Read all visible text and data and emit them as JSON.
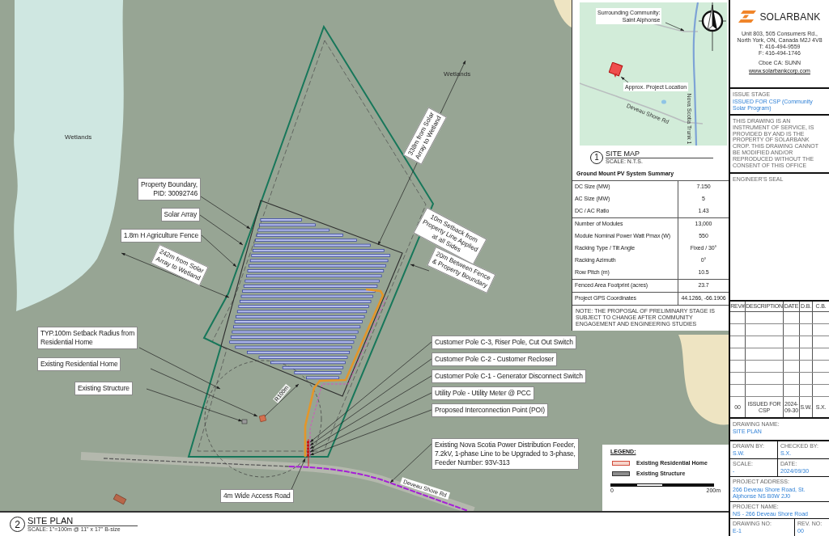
{
  "site_plan": {
    "area_labels": [
      "Wetlands",
      "Wetlands"
    ],
    "dimension_labels": [
      {
        "lines": [
          "338m from Solar",
          "Array to Wetland"
        ]
      },
      {
        "lines": [
          "242m from Solar",
          "Array to Wetland"
        ]
      },
      {
        "lines": [
          "10m Setback from",
          "Property Line Applied",
          "at all Sides"
        ]
      },
      {
        "lines": [
          "20m Between Fence",
          "& Property Boundary"
        ]
      },
      {
        "lines": [
          "R100m"
        ]
      }
    ],
    "callouts": [
      {
        "lines": [
          "Property Boundary,",
          "PID: 30092746"
        ]
      },
      {
        "lines": [
          "Solar Array"
        ]
      },
      {
        "lines": [
          "1.8m H Agriculture Fence"
        ]
      },
      {
        "lines": [
          "TYP.100m Setback Radius from",
          "Residential Home"
        ]
      },
      {
        "lines": [
          "Existing Residential Home"
        ]
      },
      {
        "lines": [
          "Existing Structure"
        ]
      },
      {
        "lines": [
          "Customer Pole C-3, Riser Pole, Cut Out Switch"
        ]
      },
      {
        "lines": [
          "Customer Pole C-2 - Customer Recloser"
        ]
      },
      {
        "lines": [
          "Customer Pole C-1 - Generator Disconnect Switch"
        ]
      },
      {
        "lines": [
          "Utility Pole - Utility Meter @ PCC"
        ]
      },
      {
        "lines": [
          "Proposed Interconnection Point (POI)"
        ]
      },
      {
        "lines": [
          "Existing Nova Scotia Power Distribution Feeder,",
          "7.2kV, 1-phase Line to be Upgraded to 3-phase,",
          "Feeder Number: 93V-313"
        ]
      },
      {
        "lines": [
          "4m Wide Access Road"
        ]
      }
    ],
    "road_label": "Deveau Shore Rd",
    "legend": {
      "title": "LEGEND:",
      "items": [
        {
          "label": "Existing Residential Home",
          "color": "#f6d5cb"
        },
        {
          "label": "Existing Structure",
          "color": "#8e8e8e"
        }
      ],
      "scale_start": "0",
      "scale_end": "200m"
    },
    "title": {
      "number": "2",
      "name": "SITE PLAN",
      "scale": "SCALE: 1\"=100m @ 11\" x 17\" B-size"
    }
  },
  "site_map": {
    "labels": [
      {
        "lines": [
          "Surrounding Community:",
          "Saint Alphonse"
        ]
      },
      {
        "lines": [
          "Approx. Project Location"
        ]
      }
    ],
    "road_labels": [
      "Deveau Shore Rd",
      "Nova Scotia Trunk 1"
    ],
    "title": {
      "number": "1",
      "name": "SITE MAP",
      "scale": "SCALE: N.T.S."
    }
  },
  "summary": {
    "title": "Ground Mount PV System Summary",
    "groups": [
      {
        "rows": [
          {
            "label": "DC Size (MW)",
            "value": "7.150"
          },
          {
            "label": "AC Size (MW)",
            "value": "5"
          },
          {
            "label": "DC / AC Ratio",
            "value": "1.43"
          }
        ]
      },
      {
        "rows": [
          {
            "label": "Number of Modules",
            "value": "13,000"
          },
          {
            "label": "Module Nominal Power Watt Pmax (W)",
            "value": "550"
          },
          {
            "label": "Racking Type / Tilt Angle",
            "value": "Fixed / 30°"
          },
          {
            "label": "Racking Azimuth",
            "value": "0°"
          },
          {
            "label": "Row Pitch (m)",
            "value": "10.5"
          }
        ]
      },
      {
        "rows": [
          {
            "label": "Fenced Area Footprint (acres)",
            "value": "23.7"
          }
        ]
      },
      {
        "rows": [
          {
            "label": "Project GPS Coordinates",
            "value": "44.1266, -66.1906"
          }
        ]
      }
    ],
    "note": "NOTE: THE PROPOSAL OF PRELIMINARY STAGE IS SUBJECT TO CHANGE AFTER COMMUNITY ENGAGEMENT AND ENGINEERING STUDIES"
  },
  "title_block": {
    "company": "SOLARBANK",
    "address": [
      "Unit 803, 505 Consumers Rd.,",
      "North York, ON, Canada M2J 4V8",
      "T:  416-494-9559",
      "F: 416-494-1746"
    ],
    "ticker": "Cboe CA: SUNN",
    "website": "www.solarbankcorp.com",
    "issue_stage": {
      "label": "ISSUE STAGE",
      "value": "ISSUED FOR CSP (Community Solar Program)"
    },
    "disclaimer": [
      "THIS DRAWING IS AN INSTRUMENT OF SERVICE, IS PROVIDED",
      "BY AND IS THE PROPERTY OF SOLARBANK CROP.",
      "THIS DRAWING CANNOT BE MODIFIED AND/OR REPRODUCED",
      "WITHOUT THE CONSENT OF THIS OFFICE"
    ],
    "seal_label": "ENGINEER'S SEAL",
    "revisions": {
      "columns": [
        "REV#",
        "DESCRIPTION",
        "DATE",
        "D.B.",
        "C.B."
      ],
      "rows": [
        [
          "00",
          "ISSUED FOR CSP",
          "2024-09-30",
          "S.W.",
          "S.X."
        ]
      ]
    },
    "drawing_name": {
      "label": "DRAWING NAME:",
      "value": "SITE PLAN"
    },
    "drawn_by": {
      "label": "DRAWN BY:",
      "value": "S.W."
    },
    "checked_by": {
      "label": "CHECKED BY:",
      "value": "S.X."
    },
    "scale": {
      "label": "SCALE:",
      "value": "-"
    },
    "date": {
      "label": "DATE:",
      "value": "2024/09/30"
    },
    "project_address": {
      "label": "PROJECT ADDRESS:",
      "lines": [
        "266 Deveau Shore Road, St.",
        "Alphonse NS B0W 2J0"
      ]
    },
    "project_name": {
      "label": "PROJECT NAME:",
      "value": "NS - 266 Deveau Shore Road"
    },
    "drawing_no": {
      "label": "DRAWING NO:",
      "value": "E-1"
    },
    "rev_no": {
      "label": "REV. NO:",
      "value": "00"
    }
  }
}
